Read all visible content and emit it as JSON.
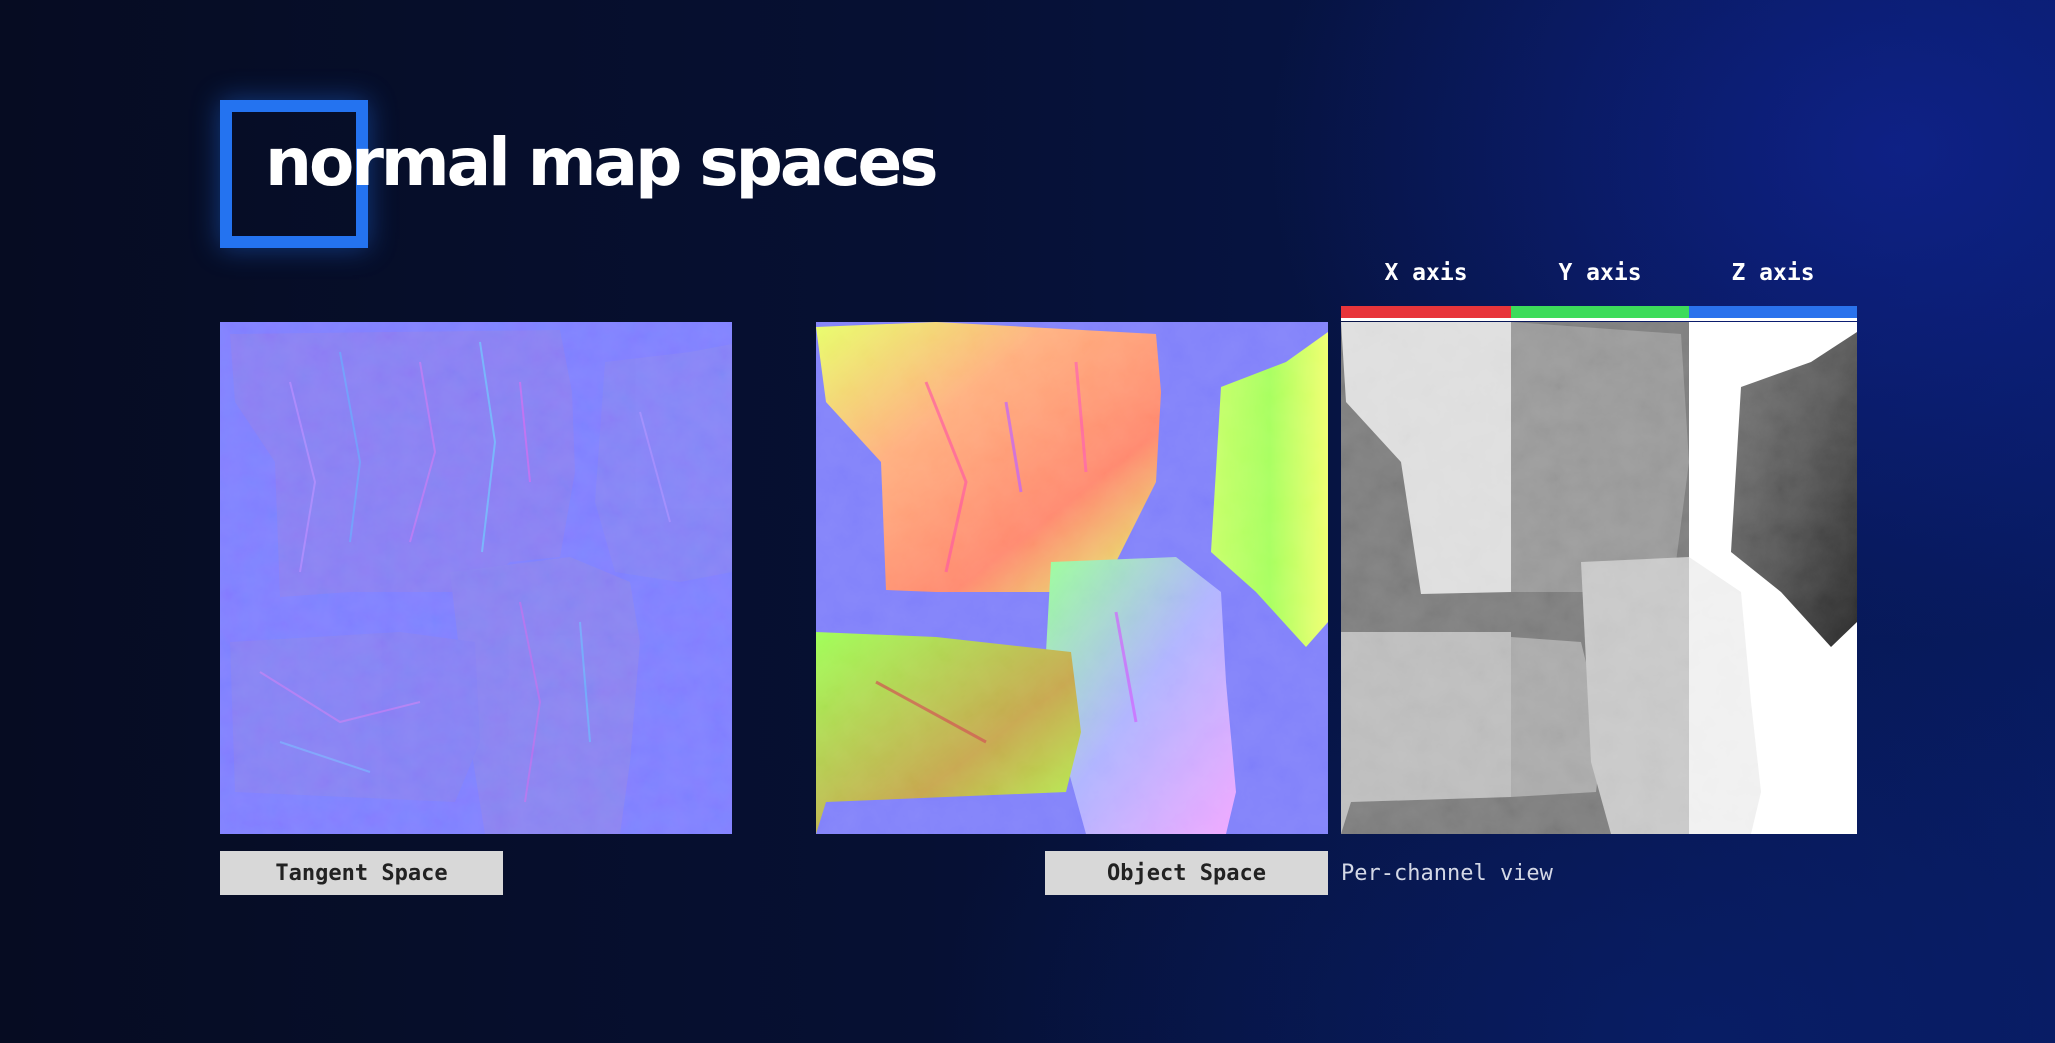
{
  "title": "normal map spaces",
  "panels": {
    "tangent_space": {
      "caption": "Tangent Space"
    },
    "object_space": {
      "caption": "Object Space"
    },
    "per_channel": {
      "caption": "Per-channel view"
    }
  },
  "axes": [
    {
      "label": "X axis",
      "color": "#e8353a"
    },
    {
      "label": "Y axis",
      "color": "#3ddc5a"
    },
    {
      "label": "Z axis",
      "color": "#2a72ec"
    }
  ],
  "colors": {
    "accent": "#2473f0",
    "tangent_base": "#8080ff"
  }
}
